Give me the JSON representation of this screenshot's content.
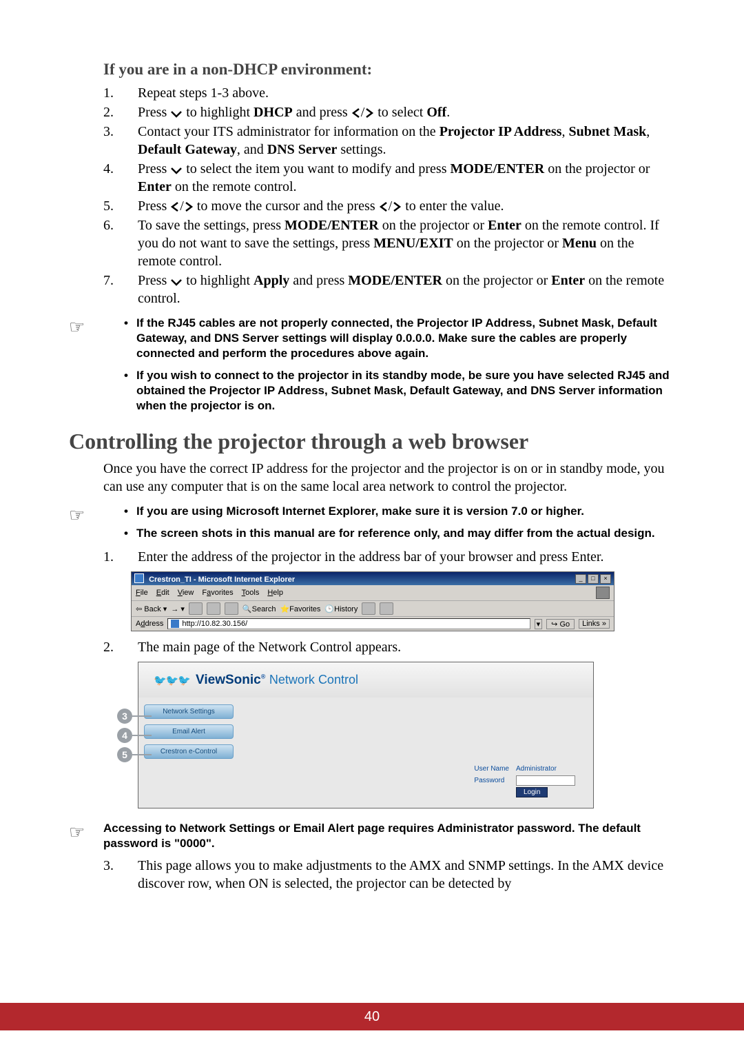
{
  "section1": {
    "heading": "If you are in a non-DHCP environment:",
    "steps": [
      {
        "n": "1.",
        "pre": "Repeat steps 1-3 above."
      },
      {
        "n": "2.",
        "pre": "Press ",
        "mid": " to highlight ",
        "b1": "DHCP",
        "mid2": " and press ",
        "mid3": " to select ",
        "b2": "Off",
        "post": "."
      },
      {
        "n": "3.",
        "pre": "Contact your ITS administrator for information on the ",
        "b1": "Projector IP Address",
        "sep1": ", ",
        "b2": "Subnet Mask",
        "sep2": ", ",
        "b3": "Default Gateway",
        "sep3": ", and ",
        "b4": "DNS Server",
        "post": " settings."
      },
      {
        "n": "4.",
        "pre": "Press ",
        "mid": " to select the item you want to modify and press ",
        "b1": "MODE/ENTER",
        "mid2": " on the projector or ",
        "b2": "Enter",
        "post": " on the remote control."
      },
      {
        "n": "5.",
        "pre": "Press ",
        "mid": " to move the cursor and the press ",
        "post": " to enter the value."
      },
      {
        "n": "6.",
        "pre": "To save the settings, press ",
        "b1": "MODE/ENTER",
        "mid": " on the projector or ",
        "b2": "Enter",
        "mid2": " on the remote control. If you do not want to save the settings, press ",
        "b3": "MENU/EXIT",
        "mid3": " on the projector or ",
        "b4": "Menu",
        "post": " on the remote control."
      },
      {
        "n": "7.",
        "pre": "Press ",
        "mid": " to highlight ",
        "b1": "Apply",
        "mid2": " and press ",
        "b2": "MODE/ENTER",
        "mid3": " on the projector or ",
        "b3": "Enter",
        "post": " on the remote control."
      }
    ]
  },
  "notes1": [
    "If the RJ45 cables are not properly connected, the Projector IP Address, Subnet Mask, Default Gateway, and DNS Server settings will display 0.0.0.0. Make sure the cables are properly connected and perform the procedures above again.",
    "If you wish to connect to the projector in its standby mode, be sure you have selected RJ45 and obtained the Projector IP Address, Subnet Mask, Default Gateway, and DNS Server information when the projector is on."
  ],
  "section2": {
    "heading": "Controlling the projector through a web browser",
    "intro": "Once you have the correct IP address for the projector and the projector is on or in standby mode, you can use any computer that is on the same local area network to control the projector."
  },
  "notes2": [
    "If you are using Microsoft Internet Explorer, make sure it is version 7.0 or higher.",
    "The screen shots in this manual are for reference only, and may differ from the actual design."
  ],
  "steps2": {
    "s1": {
      "n": "1.",
      "text": "Enter the address of the projector in the address bar of your browser and press Enter."
    },
    "s2": {
      "n": "2.",
      "text": "The main page of the Network Control appears."
    },
    "s3": {
      "n": "3.",
      "text": "This page allows you to make adjustments to the AMX and SNMP settings.  In the AMX device discover row, when ON is selected, the projector can be detected by"
    }
  },
  "ie": {
    "title": "Crestron_TI - Microsoft Internet Explorer",
    "menu": [
      "File",
      "Edit",
      "View",
      "Favorites",
      "Tools",
      "Help"
    ],
    "toolbar": {
      "back": "Back",
      "search": "Search",
      "favorites": "Favorites",
      "history": "History"
    },
    "address_label": "Address",
    "url": "http://10.82.30.156/",
    "go": "Go",
    "links": "Links"
  },
  "nc": {
    "brand": "ViewSonic",
    "title": "Network Control",
    "tabs": [
      "Network Settings",
      "Email Alert",
      "Crestron e-Control"
    ],
    "login": {
      "user_label": "User Name",
      "user_value": "Administrator",
      "pass_label": "Password",
      "login_btn": "Login"
    },
    "badges": [
      "3",
      "4",
      "5"
    ]
  },
  "notes3": "Accessing to Network Settings or Email Alert page requires Administrator password. The default password is \"0000\".",
  "page_number": "40"
}
